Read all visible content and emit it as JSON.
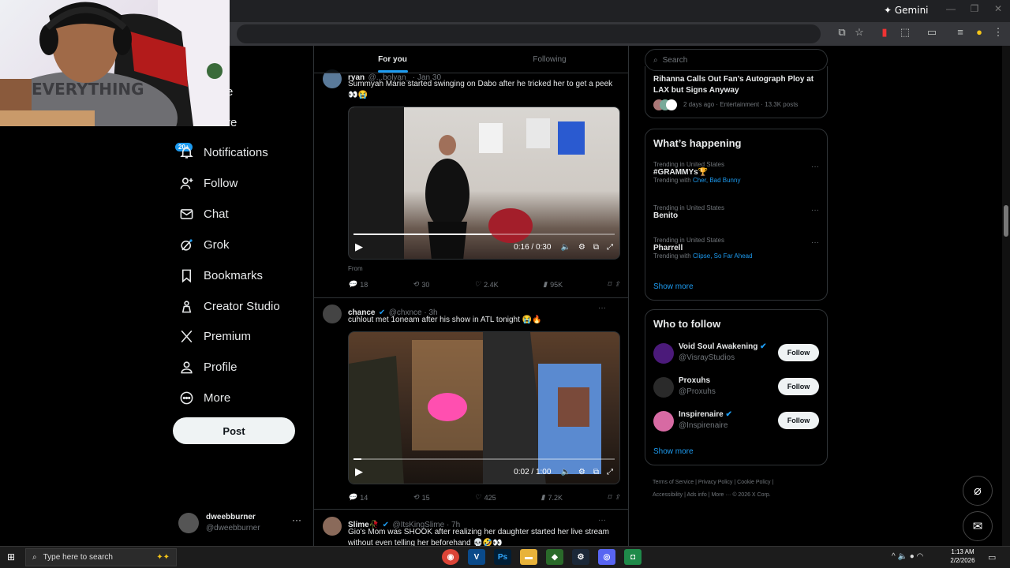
{
  "browser": {
    "gemini_label": "Gemini"
  },
  "nav": {
    "items": [
      {
        "label": "Notifications",
        "icon": "bell-icon"
      },
      {
        "label": "Follow",
        "icon": "person-plus-icon"
      },
      {
        "label": "Chat",
        "icon": "envelope-icon"
      },
      {
        "label": "Grok",
        "icon": "grok-icon"
      },
      {
        "label": "Bookmarks",
        "icon": "bookmark-icon"
      },
      {
        "label": "Creator Studio",
        "icon": "creator-studio-icon"
      },
      {
        "label": "Premium",
        "icon": "x-logo-icon"
      },
      {
        "label": "Profile",
        "icon": "person-icon"
      },
      {
        "label": "More",
        "icon": "more-circle-icon"
      }
    ],
    "partial_labels": [
      "e",
      "re"
    ],
    "notif_badge": "20+",
    "post_label": "Post",
    "account": {
      "name": "dweebburner",
      "handle": "@dweebburner"
    }
  },
  "feed": {
    "tabs": [
      {
        "label": "For you",
        "active": true
      },
      {
        "label": "Following",
        "active": false
      }
    ],
    "tweets": [
      {
        "name": "ryan",
        "meta": "@...bolyan_ · Jan 30",
        "text": "Summyah Marie started swinging on Dabo after he tricked her to get a peek 👀😭",
        "video_time": "0:16 / 0:30",
        "progress": 0.53,
        "source": "From",
        "stats": {
          "replies": "18",
          "reposts": "30",
          "likes": "2.4K",
          "views": "95K"
        }
      },
      {
        "name": "chance",
        "meta": "@chxnce · 3h",
        "text": "cuhlout met 1oneam after his show in ATL tonight 😭🔥",
        "video_time": "0:02 / 1:00",
        "progress": 0.03,
        "stats": {
          "replies": "14",
          "reposts": "15",
          "likes": "425",
          "views": "7.2K"
        }
      },
      {
        "name": "Slime🥀",
        "meta": "@ItsKingSlime · 7h",
        "text": "Gio's Mom was SHOOK after realizing her daughter started her live stream without even telling her beforehand 💀🤣👀"
      }
    ]
  },
  "right": {
    "search_placeholder": "Search",
    "top_story": {
      "title": "Rihanna Calls Out Fan's Autograph Ploy at LAX but Signs Anyway",
      "meta": "2 days ago · Entertainment · 13.3K posts"
    },
    "whats_happening": {
      "heading": "What’s happening",
      "trends": [
        {
          "category": "Trending in United States",
          "topic": "#GRAMMYs🏆",
          "with_prefix": "Trending with",
          "with": "Cher, Bad Bunny"
        },
        {
          "category": "Trending in United States",
          "topic": "Benito",
          "with_prefix": "",
          "with": ""
        },
        {
          "category": "Trending in United States",
          "topic": "Pharrell",
          "with_prefix": "Trending with",
          "with": "Clipse, So Far Ahead"
        }
      ],
      "show_more": "Show more"
    },
    "who_to_follow": {
      "heading": "Who to follow",
      "accounts": [
        {
          "name": "Void Soul Awakening",
          "handle": "@VisrayStudios",
          "verified": true,
          "avatar_color": "#4b1a7a"
        },
        {
          "name": "Proxuhs",
          "handle": "@Proxuhs",
          "verified": false,
          "avatar_color": "#2a2a2a"
        },
        {
          "name": "Inspirenaire",
          "handle": "@Inspirenaire",
          "verified": true,
          "avatar_color": "#d76aa3"
        }
      ],
      "follow_label": "Follow",
      "show_more": "Show more"
    },
    "footer": {
      "line1": [
        "Terms of Service",
        "Privacy Policy",
        "Cookie Policy"
      ],
      "line2": [
        "Accessibility",
        "Ads info",
        "More ···",
        "© 2026 X Corp."
      ]
    }
  },
  "taskbar": {
    "search_placeholder": "Type here to search",
    "time": "1:13 AM",
    "date": "2/2/2026"
  }
}
